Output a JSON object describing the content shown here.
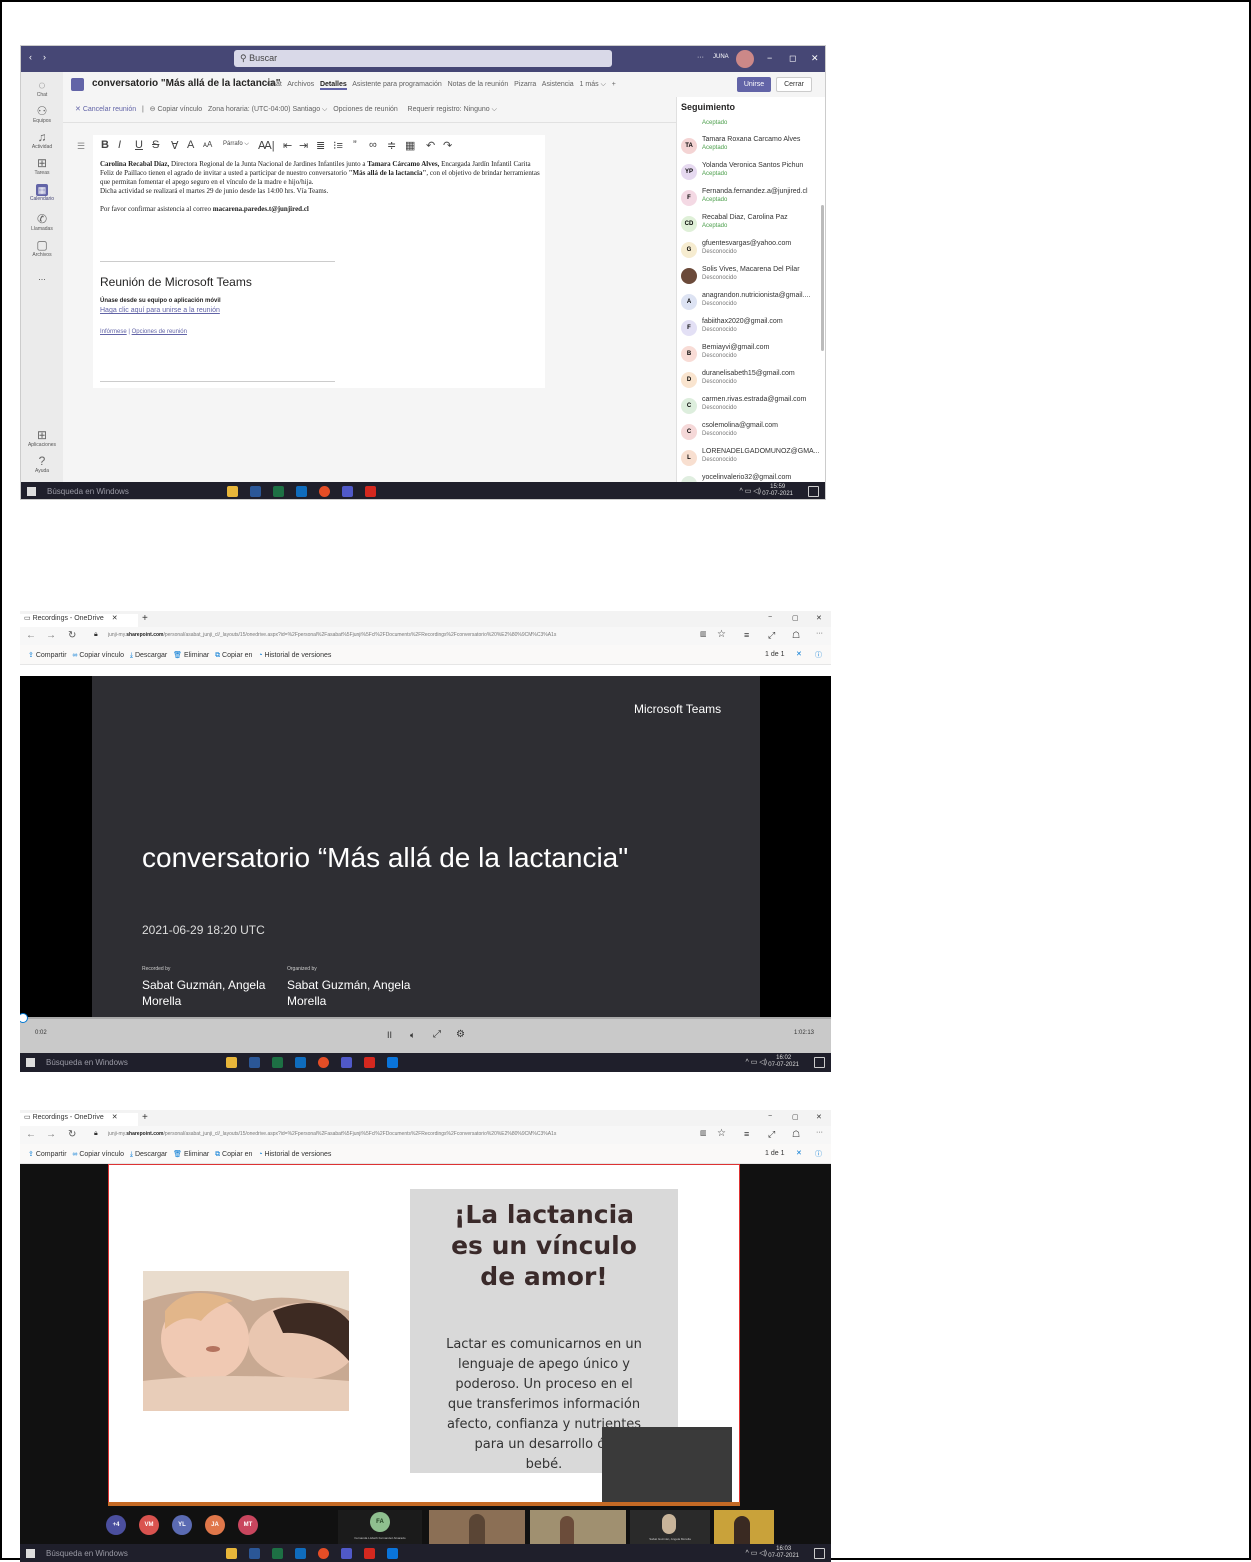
{
  "teams": {
    "search_placeholder": "Buscar",
    "user_label": "JUNA",
    "window_controls": [
      "−",
      "◻",
      "✕"
    ],
    "rail": [
      {
        "label": "Chat",
        "icon": "chat-icon"
      },
      {
        "label": "Equipos",
        "icon": "teams-icon"
      },
      {
        "label": "Actividad",
        "icon": "bell-icon"
      },
      {
        "label": "Tareas",
        "icon": "tasks-icon"
      },
      {
        "label": "Calendario",
        "icon": "calendar-icon"
      },
      {
        "label": "Llamadas",
        "icon": "phone-icon"
      },
      {
        "label": "Archivos",
        "icon": "files-icon"
      },
      {
        "label": "...",
        "icon": "more-icon"
      }
    ],
    "rail_bottom": [
      {
        "label": "Aplicaciones",
        "icon": "apps-icon"
      },
      {
        "label": "Ayuda",
        "icon": "help-icon"
      }
    ],
    "meeting_title": "conversatorio \"Más allá de la lactancia\"",
    "tabs": [
      "Chat",
      "Archivos",
      "Detalles",
      "Asistente para programación",
      "Notas de la reunión",
      "Pizarra",
      "Asistencia",
      "1 más"
    ],
    "active_tab": "Detalles",
    "join_label": "Unirse",
    "close_label": "Cerrar",
    "toolbar": {
      "cancel": "Cancelar reunión",
      "copy_link": "Copiar vínculo",
      "timezone": "Zona horaria: (UTC-04:00) Santiago",
      "options": "Opciones de reunión",
      "register": "Requerir registro: Ninguno"
    },
    "format_style": "Párrafo",
    "body_p1_bold1": "Carolina Recabal Díaz,",
    "body_p1_a": " Directora Regional de la Junta Nacional de Jardines Infantiles junto a ",
    "body_p1_bold2": "Tamara Cárcamo Alves,",
    "body_p1_b": " Encargada Jardín Infantil Carita Feliz de Paillaco tienen el agrado de invitar a usted a participar de nuestro conversatorio ",
    "body_p1_bold3": "\"Más allá de la lactancia\"",
    "body_p1_c": ", con el objetivo de brindar herramientas que permitan fomentar el apego seguro en el vínculo de la madre e hijo/hija.",
    "body_p2": "Dicha actividad se realizará el martes 29 de junio desde las 14:00 hrs. Vía Teams.",
    "body_p3_a": "Por favor confirmar asistencia al correo ",
    "body_p3_email": "macarena.paredes.t@junjired.cl",
    "teams_heading": "Reunión de Microsoft Teams",
    "join_device": "Únase desde su equipo o aplicación móvil",
    "join_link": "Haga clic aquí para unirse a la reunión",
    "info_link": "Infórmese",
    "options_link": "Opciones de reunión",
    "tracking_title": "Seguimiento",
    "tracking_top_status": "Aceptado",
    "attendees": [
      {
        "initials": "TA",
        "name": "Tamara Roxana Carcamo Alves",
        "status": "Aceptado",
        "color": "#f4d4d4"
      },
      {
        "initials": "YP",
        "name": "Yolanda Veronica Santos Pichun",
        "status": "Aceptado",
        "color": "#e6d9f0"
      },
      {
        "initials": "F",
        "name": "Fernanda.fernandez.a@junjired.cl",
        "status": "Aceptado",
        "color": "#f4d9e4"
      },
      {
        "initials": "CD",
        "name": "Recabal Diaz, Carolina Paz",
        "status": "Aceptado",
        "color": "#dff0d8"
      },
      {
        "initials": "G",
        "name": "gfuentesvargas@yahoo.com",
        "status": "Desconocido",
        "color": "#f6ecd0"
      },
      {
        "initials": "",
        "name": "Solis Vives, Macarena Del Pilar",
        "status": "Desconocido",
        "color": "#6b4a3a"
      },
      {
        "initials": "A",
        "name": "anagrandon.nutricionista@gmail....",
        "status": "Desconocido",
        "color": "#dde3f3"
      },
      {
        "initials": "F",
        "name": "fabiithax2020@gmail.com",
        "status": "Desconocido",
        "color": "#e3e0f5"
      },
      {
        "initials": "B",
        "name": "Bemiayvi@gmail.com",
        "status": "Desconocido",
        "color": "#f8dcd6"
      },
      {
        "initials": "D",
        "name": "duranelisabeth15@gmail.com",
        "status": "Desconocido",
        "color": "#f9e4cf"
      },
      {
        "initials": "C",
        "name": "carmen.rivas.estrada@gmail.com",
        "status": "Desconocido",
        "color": "#ddeedd"
      },
      {
        "initials": "C",
        "name": "csolemolina@gmail.com",
        "status": "Desconocido",
        "color": "#f5d8d8"
      },
      {
        "initials": "L",
        "name": "LORENADELGADOMUNOZ@GMA...",
        "status": "Desconocido",
        "color": "#f8dfd0"
      },
      {
        "initials": "",
        "name": "yocelinvalerio32@gmail.com",
        "status": "",
        "color": "#e0eee0"
      }
    ],
    "taskbar_search": "Búsqueda en Windows",
    "clock_time": "15:59",
    "clock_date": "07-07-2021"
  },
  "edge": {
    "tab_title": "Recordings - OneDrive",
    "url_host": "junji-my.",
    "url_domain": "sharepoint.com",
    "url_path": "/personal/asabat_junji_cl/_layouts/15/onedrive.aspx?id=%2Fpersonal%2Fasabat%5Fjunji%5Fcl%2FDocuments%2FRecordings%2Fconversatorio%20%E2%80%9CM%C3%A1s",
    "commands": [
      "Compartir",
      "Copiar vínculo",
      "Descargar",
      "Eliminar",
      "Copiar en",
      "Historial de versiones"
    ],
    "page_count": "1 de 1"
  },
  "video": {
    "brand": "Microsoft Teams",
    "title": "conversatorio “Más allá de la lactancia\"",
    "datetime": "2021-06-29 18:20 UTC",
    "recorded_by_label": "Recorded by",
    "recorded_by_a": "Sabat Guzmán, Angela",
    "recorded_by_b": "Morella",
    "organized_by_label": "Organized by",
    "organized_by_a": "Sabat Guzmán, Angela",
    "organized_by_b": "Morella",
    "current_time": "0:02",
    "duration": "1:02:13",
    "progress": 0.001,
    "clock_time": "16:02",
    "clock_date": "07-07-2021"
  },
  "slide": {
    "heading1": "¡La lactancia",
    "heading2": "es un vínculo",
    "heading3": "de amor!",
    "text_lines": [
      "Lactar es comunicarnos en un",
      "lenguaje de apego único y",
      "poderoso. Un proceso en el",
      "que transferimos información",
      "afecto, confianza y nutrientes",
      "para un desarrollo óp",
      "bebé."
    ],
    "participants": [
      {
        "initials": "+4",
        "color": "#4b4f9e"
      },
      {
        "initials": "VM",
        "color": "#d9534f"
      },
      {
        "initials": "YL",
        "color": "#5b6bb3"
      },
      {
        "initials": "JA",
        "color": "#e0774a"
      },
      {
        "initials": "MT",
        "color": "#c9465e"
      }
    ],
    "active_speaker_initials": "FA",
    "active_speaker_name": "Fernanda Lisbeth Fernandez Alvarado",
    "video_tile_name": "Sabat Guzmán, Angela Morella",
    "clock_time": "16:03",
    "clock_date": "07-07-2021"
  }
}
